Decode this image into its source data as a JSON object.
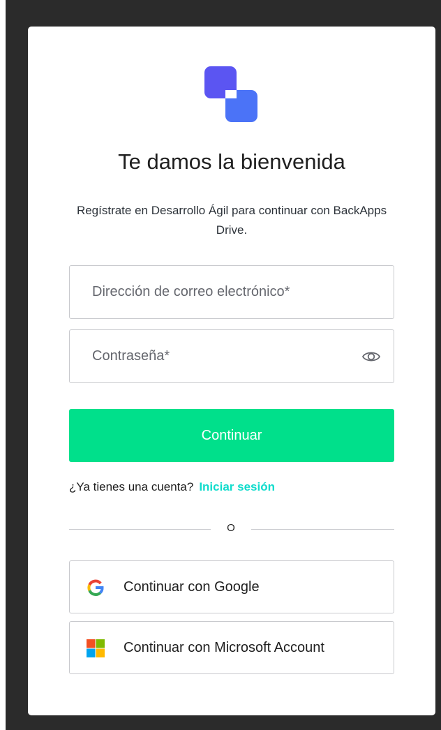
{
  "header": {
    "title": "Te damos la bienvenida",
    "subtitle": "Regístrate en Desarrollo Ágil para continuar con BackApps Drive."
  },
  "form": {
    "email_placeholder": "Dirección de correo electrónico*",
    "password_placeholder": "Contraseña*",
    "continue_label": "Continuar"
  },
  "login": {
    "prompt": "¿Ya tienes una cuenta?",
    "link_label": "Iniciar sesión"
  },
  "divider": {
    "label": "O"
  },
  "social": {
    "google_label": "Continuar con Google",
    "microsoft_label": "Continuar con Microsoft Account"
  },
  "icons": {
    "logo": "backapps-logo-icon",
    "password_toggle": "eye-icon",
    "google": "google-icon",
    "microsoft": "microsoft-icon"
  },
  "colors": {
    "accent_button": "#00e08b",
    "link": "#10dccc",
    "logo_primary": "#4f6bf5",
    "logo_secondary": "#5a52f0"
  }
}
